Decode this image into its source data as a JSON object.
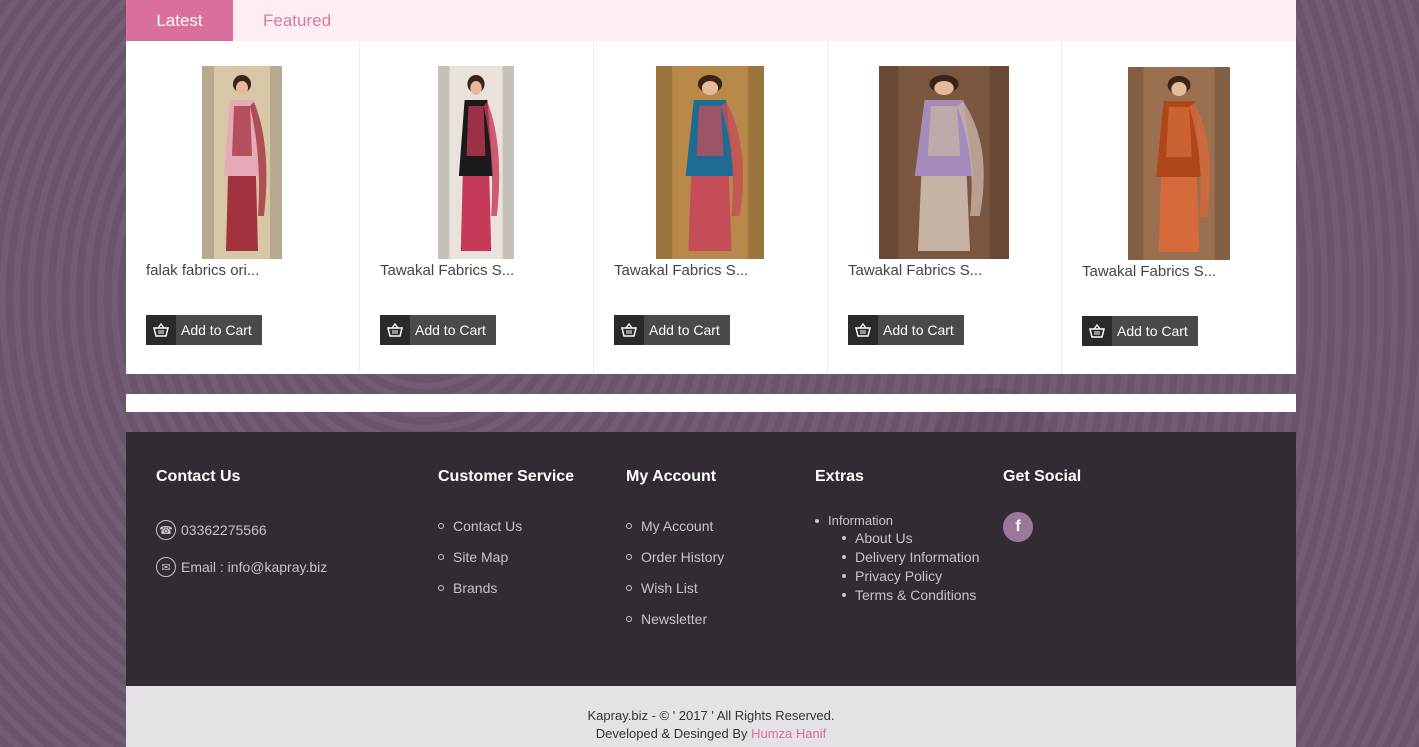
{
  "tabs": {
    "latest": "Latest",
    "featured": "Featured"
  },
  "products": [
    {
      "name": "falak fabrics ori...",
      "add_to_cart": "Add to Cart",
      "image_icon": "dress-image",
      "colors": [
        "#e7a9b8",
        "#a3323f",
        "#d8c7a6"
      ]
    },
    {
      "name": "Tawakal Fabrics S...",
      "add_to_cart": "Add to Cart",
      "image_icon": "dress-image",
      "colors": [
        "#1a1a1a",
        "#c63a59",
        "#e9e2dc"
      ]
    },
    {
      "name": "Tawakal Fabrics S...",
      "add_to_cart": "Add to Cart",
      "image_icon": "dress-image",
      "colors": [
        "#1f6c93",
        "#c54d57",
        "#b88948"
      ]
    },
    {
      "name": "Tawakal Fabrics S...",
      "add_to_cart": "Add to Cart",
      "image_icon": "dress-image",
      "colors": [
        "#a58bbb",
        "#c7b3a5",
        "#7b5740"
      ]
    },
    {
      "name": "Tawakal Fabrics S...",
      "add_to_cart": "Add to Cart",
      "image_icon": "dress-image",
      "colors": [
        "#b04718",
        "#d66a3b",
        "#9b7050"
      ]
    }
  ],
  "footer": {
    "contact": {
      "heading": "Contact Us",
      "phone": "03362275566",
      "email": "Email : info@kapray.biz"
    },
    "customer_service": {
      "heading": "Customer Service",
      "links": [
        "Contact Us",
        "Site Map",
        "Brands"
      ]
    },
    "my_account": {
      "heading": "My Account",
      "links": [
        "My Account",
        "Order History",
        "Wish List",
        "Newsletter"
      ]
    },
    "extras": {
      "heading": "Extras",
      "parent": "Information",
      "links": [
        "About Us",
        "Delivery Information",
        "Privacy Policy",
        "Terms & Conditions"
      ]
    },
    "social": {
      "heading": "Get Social",
      "facebook": "f"
    }
  },
  "copyright": {
    "line1": "Kapray.biz - © ' 2017 ' All Rights Reserved.",
    "line2_prefix": "Developed & Desinged By ",
    "author": "Humza Hanif"
  },
  "colors": {
    "accent": "#db6f9c",
    "footer_bg": "#332b33",
    "tab_bg": "#fdeef4"
  }
}
